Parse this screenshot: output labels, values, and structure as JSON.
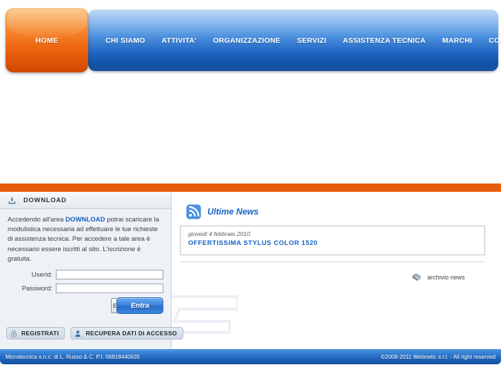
{
  "nav": {
    "home": {
      "label": "HOME",
      "icon": "home-tab"
    },
    "items": [
      {
        "label": "CHI SIAMO"
      },
      {
        "label": "ATTIVITA'"
      },
      {
        "label": "ORGANIZZAZIONE"
      },
      {
        "label": "SERVIZI"
      },
      {
        "label": "ASSISTENZA TECNICA"
      },
      {
        "label": "MARCHI"
      },
      {
        "label": "COME RAGGIUNGERCI"
      }
    ]
  },
  "download_panel": {
    "header_title": "DOWNLOAD",
    "header_icon": "download-icon",
    "intro_part1": "Accedendo all'area ",
    "intro_link": "DOWNLOAD",
    "intro_part2": " potrai scaricare la modulistica necessaria ad effettuare le tue richieste di assistenza tecnica. Per accedere a tale area è necessario essere iscritti al sito. L'iscrizione è gratuita.",
    "form": {
      "userid_label": "Userid:",
      "userid_value": "",
      "userid_placeholder": "",
      "password_label": "Password:",
      "password_value": "",
      "password_placeholder": "",
      "submit_label": "Entra",
      "hidden_submit_label": "E"
    },
    "actions": [
      {
        "label": "REGISTRATI",
        "icon": "lock-icon"
      },
      {
        "label": "RECUPERA DATI DI ACCESSO",
        "icon": "user-icon"
      }
    ]
  },
  "news": {
    "title": "Ultime News",
    "title_icon": "rss-icon",
    "items": [
      {
        "date": "giovedì 4 febbraio 2010",
        "headline": "OFFERTISSIMA STYLUS COLOR 1520"
      }
    ],
    "archive_label": "archivio news",
    "archive_icon": "archive-icon"
  },
  "footer": {
    "left": "Microtecnica s.n.c. di L. Russo & C. P.I. 06818440635",
    "right": "©2008-2011 Webnetic s.r.l. - All right reserved"
  },
  "colors": {
    "orange_accent": "#e55c0c",
    "blue_accent": "#1463c6",
    "panel_bg": "#eef1f5",
    "nav_blue_dark": "#14539f",
    "nav_orange_dark": "#d04a02"
  }
}
